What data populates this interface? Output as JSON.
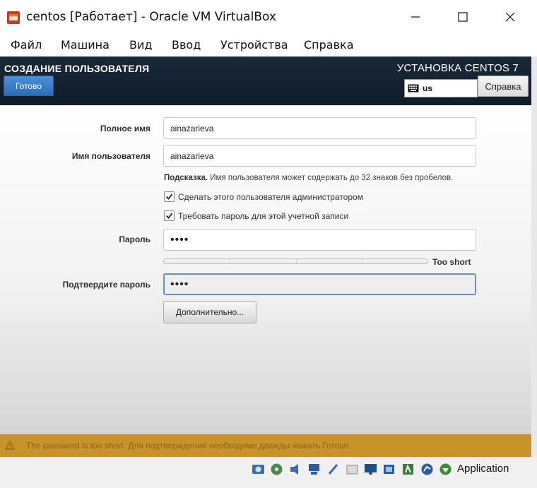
{
  "window": {
    "title": "centos [Работает] - Oracle VM VirtualBox",
    "app_icon": "virtualbox-icon"
  },
  "menu": [
    "Файл",
    "Машина",
    "Вид",
    "Ввод",
    "Устройства",
    "Справка"
  ],
  "header": {
    "screen_title": "СОЗДАНИЕ ПОЛЬЗОВАТЕЛЯ",
    "installer_title": "УСТАНОВКА CENTOS 7",
    "done_button": "Готово",
    "keyboard_layout": "us",
    "help_button": "Справка"
  },
  "form": {
    "fullname_label": "Полное имя",
    "fullname_value": "ainazarieva",
    "username_label": "Имя пользователя",
    "username_value": "ainazarieva",
    "hint_bold": "Подсказка.",
    "hint_text": " Имя пользователя может содержать до 32 знаков без пробелов.",
    "admin_checkbox_label": "Сделать этого пользователя администратором",
    "admin_checked": true,
    "require_password_label": "Требовать пароль для этой учетной записи",
    "require_password_checked": true,
    "password_label": "Пароль",
    "password_value": "••••",
    "strength_label": "Too short",
    "strength_fraction": 0,
    "confirm_label": "Подтвердите пароль",
    "confirm_value": "••••",
    "advanced_button": "Дополнительно..."
  },
  "warning": {
    "icon": "warning-icon",
    "text": "The password is too short. Для подтверждения необходимо дважды нажать Готово."
  },
  "statusbar": {
    "icons": [
      "hard-disk-icon",
      "optical-drive-icon",
      "audio-icon",
      "network-icon",
      "usb-icon",
      "shared-folder-icon",
      "display-icon",
      "recording-icon",
      "cpu-icon",
      "mouse-integration-icon",
      "host-key-icon"
    ],
    "host_key_text": "Application"
  },
  "colors": {
    "header_bg": "#122131",
    "accent_button": "#3a7fcb",
    "warning_bg": "#c89329"
  }
}
